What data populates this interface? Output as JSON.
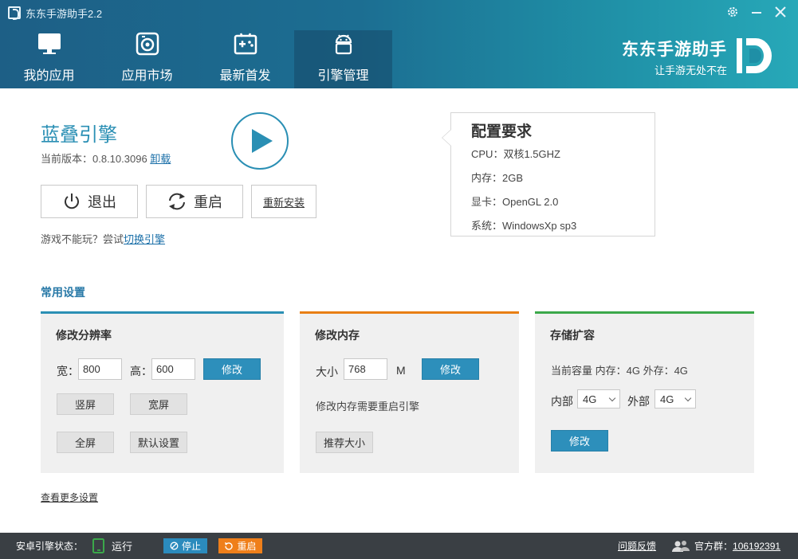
{
  "window": {
    "title": "东东手游助手2.2",
    "controls": [
      "gear-icon",
      "minimize-icon",
      "close-icon"
    ]
  },
  "nav": {
    "tabs": [
      {
        "label": "我的应用",
        "icon": "monitor-icon"
      },
      {
        "label": "应用市场",
        "icon": "store-camera-icon"
      },
      {
        "label": "最新首发",
        "icon": "gamepad-icon"
      },
      {
        "label": "引擎管理",
        "icon": "android-icon",
        "active": true
      }
    ]
  },
  "brand": {
    "name": "东东手游助手",
    "slogan": "让手游无处不在"
  },
  "engine": {
    "name": "蓝叠引擎",
    "version_label": "当前版本：0.8.10.3096 ",
    "uninstall_link": "卸载",
    "exit_label": "退出",
    "restart_label": "重启",
    "reinstall_label": "重新安装",
    "hint_prefix": "游戏不能玩？尝试",
    "hint_link": "切换引擎"
  },
  "requirements": {
    "title": "配置要求",
    "items": [
      "CPU：双核1.5GHZ",
      "内存：2GB",
      "显卡：OpenGL 2.0",
      "系统：WindowsXp sp3"
    ]
  },
  "settings": {
    "section_title": "常用设置",
    "resolution": {
      "title": "修改分辨率",
      "width_label": "宽：",
      "width_value": "800",
      "height_label": "高：",
      "height_value": "600",
      "apply_label": "修改",
      "portrait_label": "竖屏",
      "landscape_label": "宽屏",
      "fullscreen_label": "全屏",
      "default_label": "默认设置"
    },
    "memory": {
      "title": "修改内存",
      "size_label": "大小",
      "size_value": "768",
      "unit": "M",
      "apply_label": "修改",
      "note": "修改内存需要重启引擎",
      "recommend_label": "推荐大小"
    },
    "storage": {
      "title": "存储扩容",
      "current": "当前容量 内存：4G 外存：4G",
      "internal_label": "内部",
      "internal_value": "4G",
      "external_label": "外部",
      "external_value": "4G",
      "apply_label": "修改"
    },
    "more_link": "查看更多设置"
  },
  "statusbar": {
    "engine_status_label": "安卓引擎状态：",
    "running_label": "运行",
    "stop_label": "停止",
    "reboot_label": "重启",
    "feedback_label": "问题反馈",
    "group_label": "官方群：",
    "group_number": "106192391",
    "colors": {
      "stop": "#2b8bbd",
      "reboot": "#ef7f1a",
      "running": "#3ba84a"
    }
  }
}
